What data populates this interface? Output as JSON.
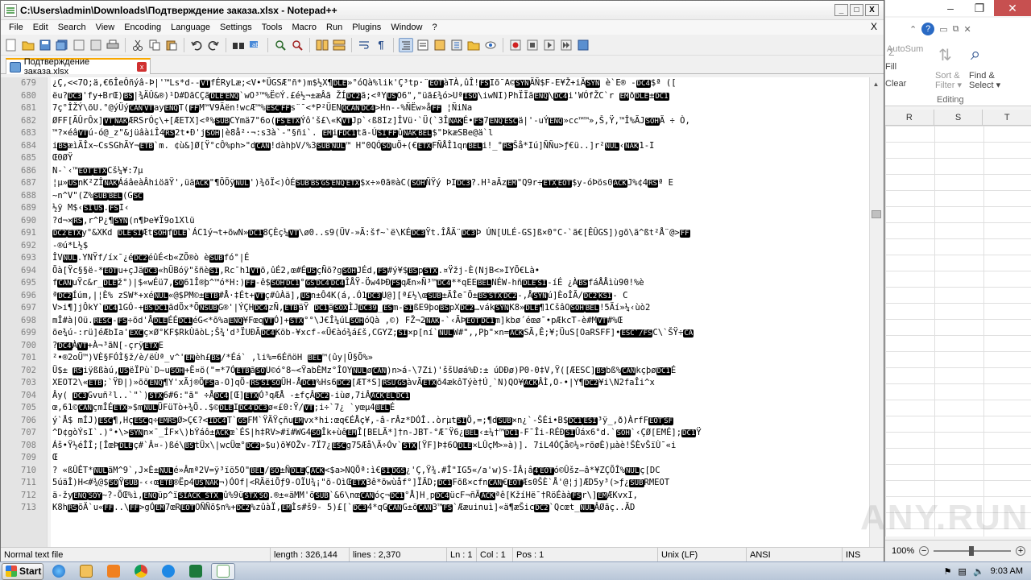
{
  "window": {
    "title": "C:\\Users\\admin\\Downloads\\Подтверждение заказа.xlsx - Notepad++",
    "min_label": "_",
    "max_label": "□",
    "close_label": "X"
  },
  "menu": [
    "File",
    "Edit",
    "Search",
    "View",
    "Encoding",
    "Language",
    "Settings",
    "Tools",
    "Macro",
    "Run",
    "Plugins",
    "Window",
    "?"
  ],
  "menu_close": "X",
  "tab": {
    "label": "Подтверждение заказа.xlsx",
    "close": "x"
  },
  "editor": {
    "lines": [
      {
        "n": "679",
        "t": "¿Ç,<<7O;ä,€6ÎeÔñýâ-Þ|'™Ls*d--[VT]fÉRyLæ;<V•*ÜGSÆ\"ñ*)m$½X¶[DLE]»°óQà%lik'Ç³tp·¨[EOT]àTÀ,ûÎ![FS]Iõ¯A©[SYN]ÄÑ$F-E¥Ž+iÄ[SYN] è`E® -[DC4]$ª (["
      },
      {
        "n": "680",
        "t": "ëu?[DC3]'fy+BrŒ)[BS]|¾ÄÛ&®)¹D#DãCÇã[DLE][ENQ]`wO³™%Ë©Ý.£é½¬±æÂã ŽÍ[DC2]ã;<ªY[US]O6\",\"üã£¾ó>Uª[ISO]\\iwNI)PhÏÏã[ENQ]\\[DC4]i'WÓfŽC`r [EM]ð[DLE]±[DC1]"
      },
      {
        "n": "681",
        "t": "7ç°ÎŽÝ\\õU.°@ýÜý[CAN][VT]ay[ENQ]T([FF]M™V9Äën!wcÆ™%[ESC][FF]s¨¯<*P²ÜEN[QCAN][DC4]>Hn--%ÑËw»å[FF] ¦ÑiNa"
      },
      {
        "n": "682",
        "t": "ØFF[ÃÛrÔx][VT][NAK]ÆRSrÓç\\+[ÆETX]<ª%[SUB]CYmä7\"6o([FS][ETX]Ýô'š£\\«K[VT]Jp`‹ß8Iz]ÎVü·`Ü(`3Î[NAK]É•[FS]7[ENQ][ESC]ä|'-uÝ[ENQ]»cc™™»,Š,Ÿ,™Î%ÃJ[SOH]Ä ÷ Ò,"
      },
      {
        "n": "683",
        "t": "™?×éâ[VT]ú-ó@_z\"&jüâàiÎ4[RS]2t•Ð'j[SOH]|è8å²·¬:s3à`-\"§ñi`.  [EM]i[FDC1]tã-Ú[SI][FF]û[NAK][BEL]$\"ÞkæSBe@ä`l"
      },
      {
        "n": "684",
        "t": "i[BS]æìÄÎx~CsSGhÃY¬[ETB]`m.     ¢ù&]Ø[Ÿ°cÔ%ph>\"d[CAN]!dàhþV/%3[SUB][NUL]™    H\"0QÓ[SO]uÖ+(€[ETX]FÑÅÎ1qn[BEL]i!_°[RS]Šå*Iú]ÑÑu>ƒ€ü..]r²[NUL]‹[NAK]1-I"
      },
      {
        "n": "685",
        "t": "Œ0ØŸ"
      },
      {
        "n": "686",
        "t": "N-`‹™[EOT][ETX]Cš¼¥:7µ"
      },
      {
        "n": "687",
        "t": "¦µ»[US]nK²ZÎ[NAK]ÁáâeàÂhiöãŸ',üä[ACK]\"¶ÕÕÿ[NUL]')¾õÏ<)ÒÉ[SUB][BS][GS][ENQ][ETX]$x÷»0ã®àC([SOH]ÑŸý ÞI[DC3]?.H¹aÄz[EM]\"Q9r÷[ETX][EOT]$y-óÞös0[ACK]J%¢4[RS]ª E"
      },
      {
        "n": "688",
        "t": "~n^V\"(Z%[SUB][BEL](G[SC]"
      },
      {
        "n": "689",
        "t": "½ÿ M$‹[SI][US].[FS]I‹"
      },
      {
        "n": "690",
        "t": "?d¬×[RS],r^P¿¶[SYN](n¶Þe¥Ï9o1Xlü"
      },
      {
        "n": "691",
        "t": "[DC2][ETX]y°&XKd [DLE][SI]Æt[SOH]f[DLE]`ÁC1ý¬t+õwN»[DC1]8ÇÈç¼[VT]\\ø0..s9(ÜV-»Ã:šf~`ë\\KÉ[DC3]Ÿt.ÎÅÄ¨[DC3]Þ ÚN[ULÉ-GS]ß×0°C-`ã€[ÊÛGS])gõ\\ã^ßt²Å¨@>[FF]"
      },
      {
        "n": "692",
        "t": "-®ú*L½$"
      },
      {
        "n": "693",
        "t": "ÎV[NUL].YNŸf/íx¯¿é[DC2]éûÉ<b«ZÕ®ò è[SUB]fó°|É"
      },
      {
        "n": "694",
        "t": "Õà[Ÿc§§ë-*[EOT]u+çJä[DC3]«hÜBóÿ\"šñè[SI],Rc¯h1[VT]õ,ûÉ2,œ#É[US]çÑõ?g[SOH]JÉd,[FS]#ý¥$[BS]p[STX].¤Ÿžj-È(NjB<»IYÕ€Là•"
      },
      {
        "n": "695",
        "t": "f[CAN]uŸc&r_[DLE]ž°)|$«wÉü7,[SO]61Î®þ^™ó*H:)[FF]-ê$[SOH][DC1]°[GS][DC4][DC4]ÎÅŸ-Öw4ÞÐ[FS]qÆn»Ñ³™[DC4]**qEE[BEL]NÉW-hñ[DLE][SI]-íÉ   ¿À[BS]fáÅÅìù90!%è"
      },
      {
        "n": "696",
        "t": "ª[DC2]Íúm,|¦È% zSW*+xé[NUL]«@$PM©±[ETB]#Å·‡Ét+[VT]ç#ûÀä],[US]n±Ô4K(á,.Ó1[DC3]U@][ª£½\\œ[SUB]±ÃÎe¯Ö±[BS][STX][DC2]-,Å[SYN]ú]ÈoÎÃ/[DC2][KSI]-     C"
      },
      {
        "n": "697",
        "t": "V>i¶]jÔkY`[DC4]1GÓ-+[BS][DC1]ãdÖx*Õ[NSUB]G®'|ÝÇH[DC4]zÑ,[ETB]äŸ    [DC1]ä[SOX]ÌJ[DC39]_[ES]m-[SI]ßE9þo[BS]pX[DC2]…vák[SYN]K8»[DLE]¶1CšâO[SOH][BEL]!5Äí»¼‹ùò2"
      },
      {
        "n": "698",
        "t": "mÎ#à|Oü.[RESC]-[FS]÷õd'Å[DLE]ÉÉ[DC1]éG<*õ%a[ENQ]¥Fœq[VT]Ó]+[STX]°°\\J€Î¼úL[SOH]óQà     ,©) FŽ¬2[NAK]-`‹ÃÞ[EOT][DC1]m]kbø´éœø¯•pÆkcT-è#M[VT]#%Œ"
      },
      {
        "n": "699",
        "t": "õe¾ú-:rü]éÆbIa'[EXC]ç×Ø°KF$RkÙãòL;Š¾'d³ÏUÐÃ[DC4]Köb-¥xcf-«Ü€àó¾á£š,CGYZ;[SI]×p[ní`[NUL]W#\",,Pþ\"×n=[ACK]SÃ,Ê;¥;ÜuS[OaRSFF]•[ESC`/FS]C\\`ŠŸ÷[CA]"
      },
      {
        "n": "700",
        "t": "?[DC4]À[VT]+À¬³ãN[-çrÿ[ETX]E"
      },
      {
        "n": "701",
        "t": "²•®2oÜ™)VÈ§FÓÌ§ž/è/ëÙª_v^'[EM]èh£[BS]/*Éá`     ,li%=6ÉñöH  [BEL]™(ûy|Ü§Õ%»"
      },
      {
        "n": "702",
        "t": "Ü$±  [RS]iÿßßàú,[US]ëÏPù`D~u[SOH]+Ë¤ö(\"=*7Ó[ETB]ã[SO]U©ó°8~<ŸabÈMz°ÎOY[NUL]ø[CAN])n>á-\\7Zi)'ššUøá%Ð:±   úDÐø)P0-0‡V,Ÿ([ÆESC][BS]bß%[CAN]kçþø[DC1]É"
      },
      {
        "n": "703",
        "t": "XEOT2\\«[ETB];`ŸÐ|)»õõ[ENQ]¶Y'xÃj®Ö[FS]a-O]qÖ-[RS][SI][SO]ÜH-Å[DC1]%Hs6[DC2][ÆT*S][RSU][GS]àvÃ[ETX]õ4ækôTýè†Ú¸`N)QO¥[ACK]ÂÌ,O-•|Y¶[DC2]¥i\\N2faÎi^x"
      },
      {
        "n": "704",
        "t": "Ây(  [DC3]Gvuñ²l..`\"`)[STX]6#6:\"ã\" ÷Å[DC4][Œ][ETX]Ó³qÆÅ  -±fçÂ[DC2]-iùø,7iÂ[ACK][EL][DC1]"
      },
      {
        "n": "705",
        "t": "œ,61©[CAN]çmÎÉ[ETX]»$m[NUL]ÜFüTò+¾Õ..$©[DLE]I[DC4][DC3]ø«£0:Ÿ/[VT];i÷`7¿ `yœµ4[BEL]É"
      },
      {
        "n": "706",
        "t": "ý`Å$ mÍJ)[ESC]¶,Hç[ESC]q÷[EMRS]Ø>Ç€?<[IDC4]T`[GS]FM`ŸÃŸçñu[EM]vx*hi:œq€ÉÅç¥,-â-rÂz*DÓÎ..òrµt[SI]Ö‚=;¶d[SUB]×n¿`-ŠÉi•B$[DC1][ESI]³ÿ_,ð)ÀrfF[EOT][SF]"
      },
      {
        "n": "707",
        "t": "^D¢gòÝsI`.)°•\\>[SYN]n×¯_ÍF×\\)bÝáô±[ACK]œ`ÉS|h‡RV>#ï#WG4[SO]Îk+ùê[EM]Î[BELÃ*]†n-JBT-°Æ¯Ÿ6¿[BEL]‹±¼†™[DC1]-F¯Îi-RÉÐ[SI]Ûáx6°d.`[SOH]`‹ÇØ[EMÉ];[DC1]Ÿ"
      },
      {
        "n": "708",
        "t": "Áš•Ÿ½éÎÎ;[ÎœÞ[DLE]ç#`Â¤-)ßé\\[BS]tÜx\\|wcÜœ°[DC2]»$u)õ¥OŽv-7Ï7¿[ESC]g75Æå\\Ã÷Óv`[STX][ŸF]Þ‡6O[DLE]×LÛçM>»à)].  7iL4ÓÇå©¼»rõøÈ)µàè!ŠÈvŠïÙ¯«i"
      },
      {
        "n": "709",
        "t": "Œ"
      },
      {
        "n": "710",
        "t": "?  «ßÛÊT*[NUL]ãM^9`,J×È±[NUL]é»Âmª2V=ÿ³ïö5O\"[BEL]/[SO]±Ñ[DLE]Ç[ACK]<$a>NQÕª:ì€[SI][DGS]¿'Ç,Ÿ¾.#Î\"IG5«/a'w)S-ÍÂ¡â[4][EOT]ó©Ûšz–â*¥ZÇÕÎ%[NUL]ç[DC"
      },
      {
        "n": "711",
        "t": "5úäÎ)H<#¾@$[SO]Ÿ[SUB]-‹‹œ[ETB]®Ëp4[US][NAK]¬)ÓOf|<RÃëiÕƒ9-OÏU¾¡\"õ-OìŒ[ETX]3ê*õwùåf°]ÏÃD;[DC1]Fõß×cfn[CAN]€[EOT]Æs0ŠÈ`Å'@¦j]ÆD5y³(>ƒ¿[SUB]RMEOT"
      },
      {
        "n": "712",
        "t": "ä-žy[ENQ][SOY]~?-ÕŒ%ì,[ENQ]üp^ï[SIACK_STX_]û%9ü[STX][SO].®±«äMM'õ[SUB]`&6\\nœ[CAN]óç¬[DC1]°Å]H¸p[DC4]ücF¬ñÄ[ACK]ªê[KžíHë¯†RöÉàà[FS]r\\][EM]ÆKvxI,"
      },
      {
        "n": "713",
        "t": "K8h[RS]õÄ`u«[FF]..\\[FF]>gÓ[EM]7œR[EOT]OÑÑõ$n%+[DC2]%zûàÏ,[EM]Ìs#š9-  5)£[`[DC3]4*qG[CAN]G±õ[CAN]3™[FS]`Ææuinuì]«ä¶æŠic[DC2]`Qcœt_[NUL]ÂØãç..ÃD"
      }
    ]
  },
  "status": {
    "filetype": "Normal text file",
    "length": "length : 326,144",
    "lines": "lines : 2,370",
    "ln": "Ln : 1",
    "col": "Col : 1",
    "pos": "Pos : 1",
    "eol": "Unix (LF)",
    "encoding": "ANSI",
    "mode": "INS"
  },
  "excel": {
    "autosum": "AutoSum",
    "fill": "Fill",
    "clear": "Clear",
    "sort_filter": "Sort &\nFilter",
    "find_select": "Find &\nSelect",
    "editing": "Editing",
    "columns": [
      "R",
      "S",
      "T"
    ],
    "zoom": "100%"
  },
  "taskbar": {
    "start": "Start",
    "time": "9:03 AM"
  },
  "watermark": "ANY.RUN"
}
